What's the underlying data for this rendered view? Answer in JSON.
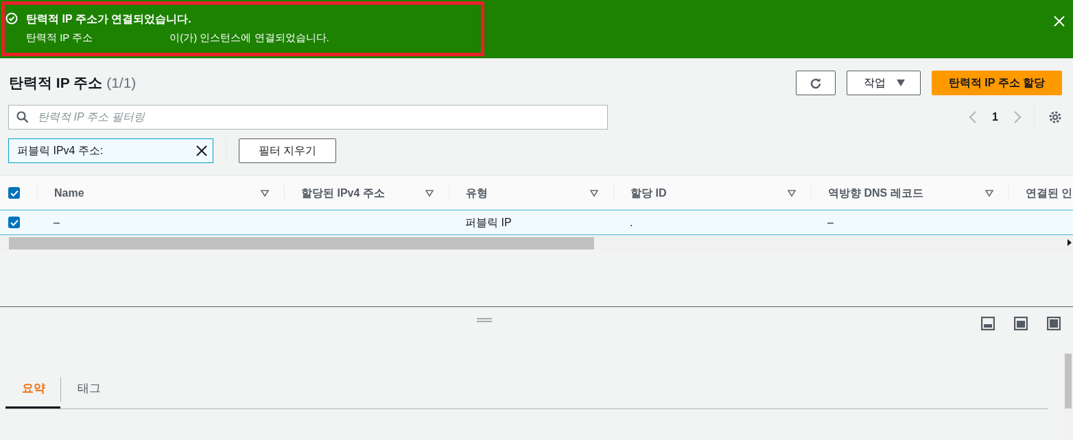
{
  "flash": {
    "title": "탄력적 IP 주소가 연결되었습니다.",
    "message_start": "탄력적 IP 주소",
    "message_end": "이(가) 인스턴스에 연결되었습니다."
  },
  "header": {
    "title": "탄력적 IP 주소",
    "count": "(1/1)",
    "actions_button": "작업",
    "primary_button": "탄력적 IP 주소 할당"
  },
  "search": {
    "placeholder": "탄력적 IP 주소 필터링"
  },
  "pagination": {
    "page": "1"
  },
  "filter_token": {
    "label": "퍼블릭 IPv4 주소:"
  },
  "clear_filters": "필터 지우기",
  "table": {
    "select_all_checked": true,
    "columns": [
      "Name",
      "할당된 IPv4 주소",
      "유형",
      "할당 ID",
      "역방향 DNS 레코드",
      "연결된 인"
    ],
    "rows": [
      {
        "checked": true,
        "cells": [
          "–",
          "",
          "퍼블릭 IP",
          ".",
          "–",
          ""
        ]
      }
    ]
  },
  "detail_tabs": [
    {
      "label": "요약",
      "selected": true
    },
    {
      "label": "태그",
      "selected": false
    }
  ]
}
